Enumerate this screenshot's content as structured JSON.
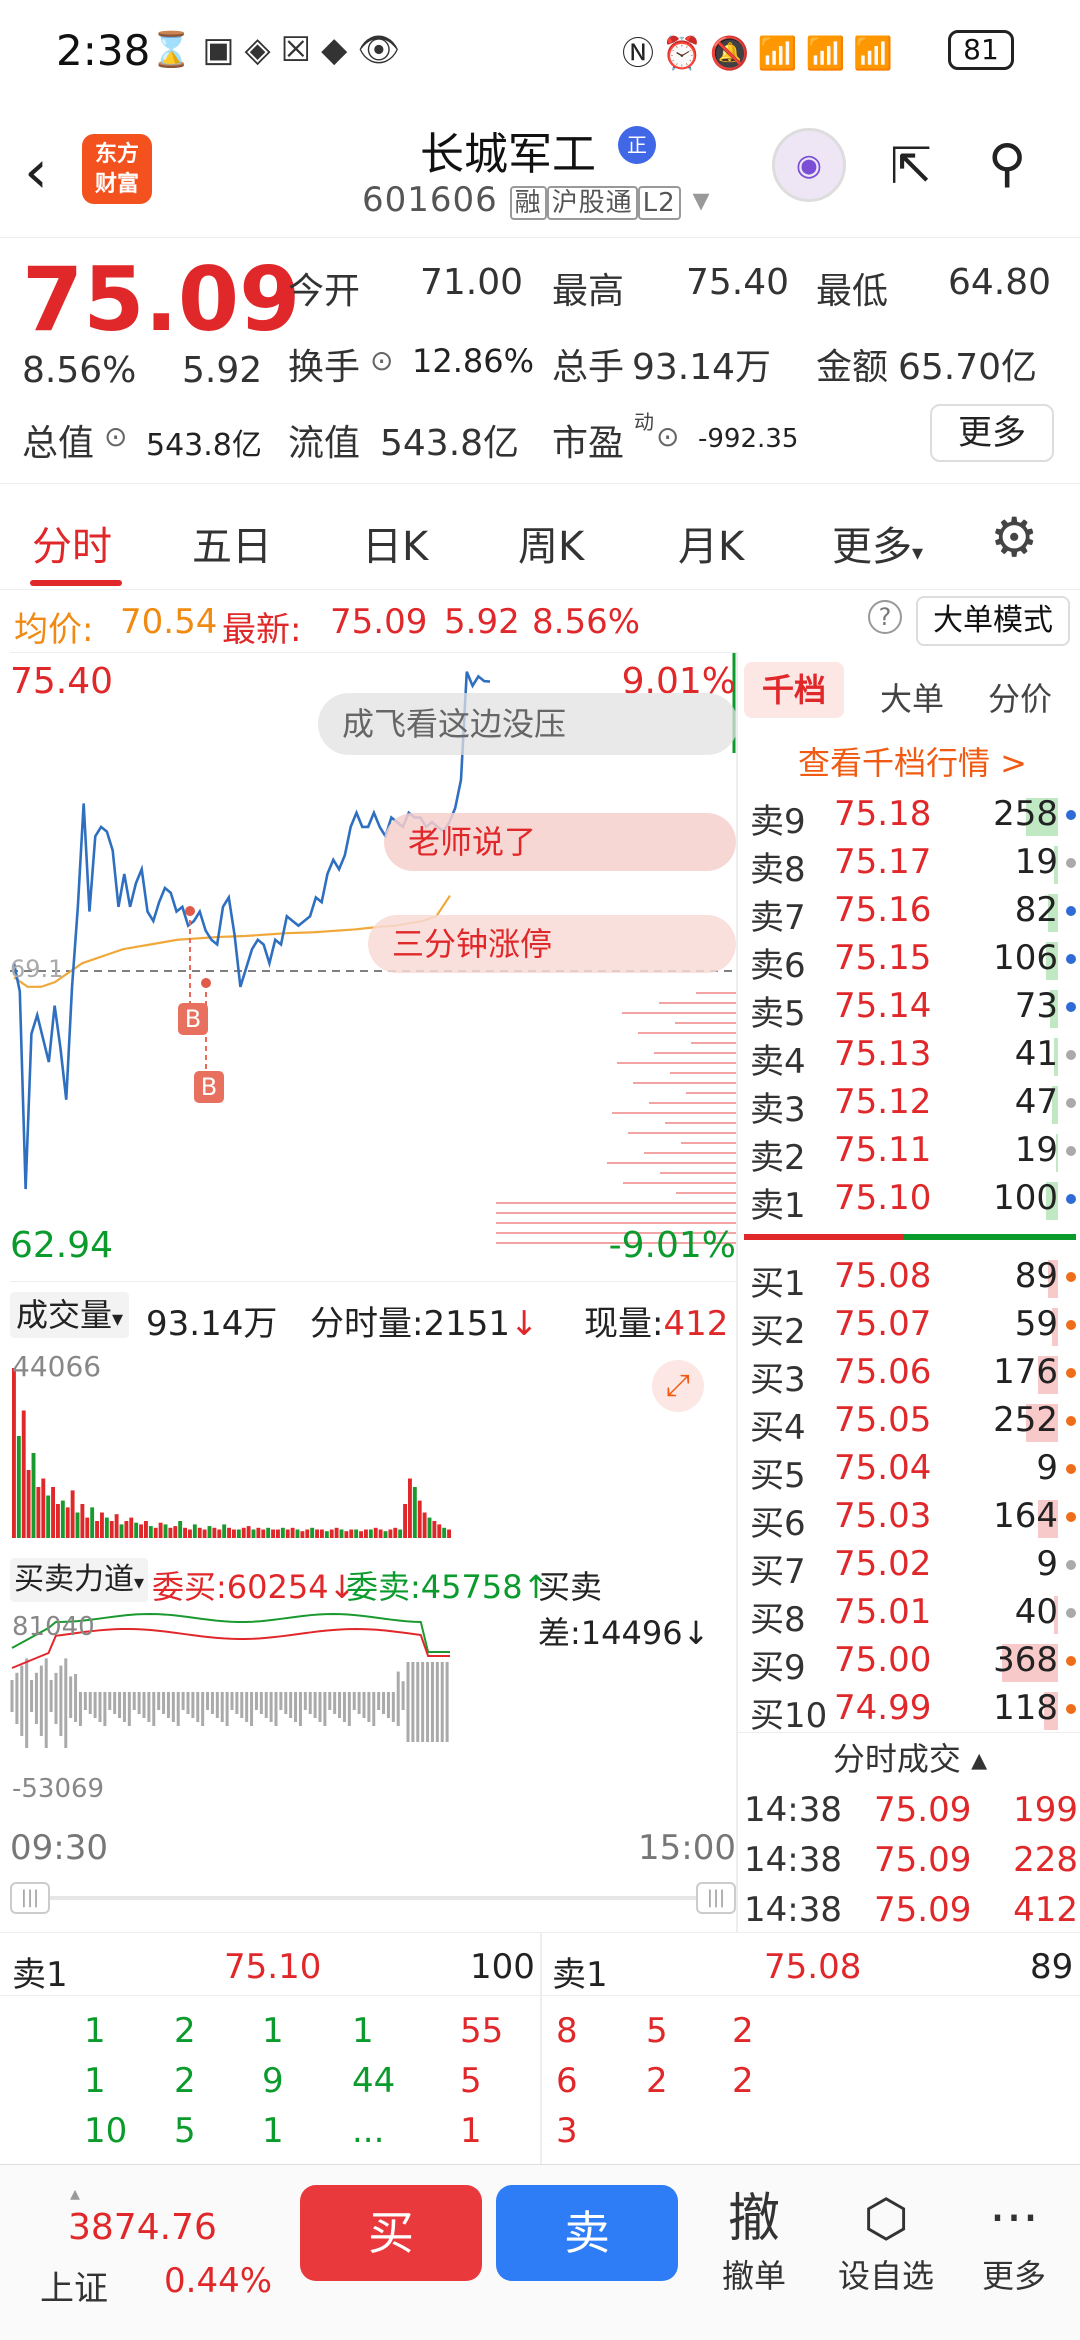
{
  "status_bar": {
    "time": "2:38",
    "battery": "81"
  },
  "header": {
    "title": "长城军工",
    "title_badge": "正",
    "code": "601606",
    "tags": [
      "融",
      "沪股通",
      "L2"
    ],
    "logo_line1": "东方",
    "logo_line2": "财富"
  },
  "quote": {
    "price": "75.09",
    "change_pct": "8.56%",
    "change": "5.92",
    "open_label": "今开",
    "open": "71.00",
    "high_label": "最高",
    "high": "75.40",
    "low_label": "最低",
    "low": "64.80",
    "turnover_label": "换手",
    "turnover": "12.86%",
    "volume_label": "总手",
    "volume": "93.14万",
    "amount_label": "金额",
    "amount": "65.70亿",
    "mktcap_label": "总值",
    "mktcap": "543.8亿",
    "float_label": "流值",
    "float": "543.8亿",
    "pe_label": "市盈",
    "pe_sup": "动",
    "pe": "-992.35",
    "more_label": "更多"
  },
  "tabs": [
    "分时",
    "五日",
    "日K",
    "周K",
    "月K",
    "更多"
  ],
  "avg_row": {
    "avg_label": "均价:",
    "avg": "70.54",
    "latest_label": "最新:",
    "latest": "75.09",
    "change": "5.92",
    "change_pct": "8.56%",
    "mode_label": "大单模式"
  },
  "chart": {
    "price_high": "75.40",
    "price_low": "62.94",
    "pct_high": "9.01%",
    "pct_low": "-9.01%",
    "mid_label": "69.1",
    "marker_label": "B",
    "overlays": [
      "成飞看这边没压",
      "老师说了",
      "三分钟涨停"
    ]
  },
  "chart_data": {
    "type": "line",
    "title": "",
    "ylim": [
      62.94,
      75.4
    ],
    "series": [
      {
        "values": [
          69.1,
          68.5,
          64.3,
          67.6,
          68.0,
          67.5,
          67.0,
          68.2,
          67.3,
          66.2,
          68.6,
          70.3,
          72.5,
          70.2,
          71.8,
          72.0,
          71.9,
          71.5,
          70.3,
          71.0,
          70.3,
          70.8,
          71.1,
          70.2,
          70.0,
          70.4,
          70.7,
          70.6,
          70.2,
          70.3,
          69.9,
          70.0,
          70.2,
          69.8,
          69.6,
          69.5,
          70.3,
          70.5,
          69.7,
          68.6,
          69.0,
          69.4,
          69.6,
          69.5,
          69.1,
          69.6,
          69.5,
          70.1,
          70.0,
          69.9,
          70.0,
          70.1,
          70.5,
          70.4,
          71.0,
          71.3,
          71.1,
          71.4,
          72.0,
          72.3,
          72.0,
          72.0,
          72.3,
          72.0,
          71.8,
          72.2,
          72.1,
          72.0,
          72.3,
          72.2,
          72.2,
          72.0,
          72.1,
          72.0,
          71.9,
          72.1,
          72.4,
          73.0,
          75.3,
          75.0,
          75.2,
          75.1,
          75.09
        ]
      },
      {
        "values": [
          68.8,
          68.6,
          68.6,
          68.7,
          68.9,
          69.1,
          69.2,
          69.3,
          69.4,
          69.45,
          69.5,
          69.55,
          69.6,
          69.62,
          69.64,
          69.66,
          69.67,
          69.68,
          69.7,
          69.72,
          69.74,
          69.75,
          69.76,
          69.78,
          69.8,
          69.82,
          69.85,
          69.88,
          69.9,
          69.95,
          70.0,
          70.1,
          70.54
        ]
      }
    ]
  },
  "book": {
    "tabs": [
      "千档",
      "大单",
      "分价"
    ],
    "link": "查看千档行情 >",
    "asks": [
      {
        "label": "卖9",
        "price": "75.18",
        "vol": "258",
        "bar": 0.16,
        "dot": "#2e6bd6"
      },
      {
        "label": "卖8",
        "price": "75.17",
        "vol": "19",
        "bar": 0.02,
        "dot": "#aaaaaa"
      },
      {
        "label": "卖7",
        "price": "75.16",
        "vol": "82",
        "bar": 0.05,
        "dot": "#2e6bd6"
      },
      {
        "label": "卖6",
        "price": "75.15",
        "vol": "106",
        "bar": 0.06,
        "dot": "#2e6bd6"
      },
      {
        "label": "卖5",
        "price": "75.14",
        "vol": "73",
        "bar": 0.04,
        "dot": "#2e6bd6"
      },
      {
        "label": "卖4",
        "price": "75.13",
        "vol": "41",
        "bar": 0.02,
        "dot": "#aaaaaa"
      },
      {
        "label": "卖3",
        "price": "75.12",
        "vol": "47",
        "bar": 0.03,
        "dot": "#aaaaaa"
      },
      {
        "label": "卖2",
        "price": "75.11",
        "vol": "19",
        "bar": 0.01,
        "dot": "#aaaaaa"
      },
      {
        "label": "卖1",
        "price": "75.10",
        "vol": "100",
        "bar": 0.06,
        "dot": "#2e6bd6"
      }
    ],
    "bids": [
      {
        "label": "买1",
        "price": "75.08",
        "vol": "89",
        "bar": 0.05,
        "dot": "#ef6c1a"
      },
      {
        "label": "买2",
        "price": "75.07",
        "vol": "59",
        "bar": 0.03,
        "dot": "#ef6c1a"
      },
      {
        "label": "买3",
        "price": "75.06",
        "vol": "176",
        "bar": 0.1,
        "dot": "#ef6c1a"
      },
      {
        "label": "买4",
        "price": "75.05",
        "vol": "252",
        "bar": 0.16,
        "dot": "#ef6c1a"
      },
      {
        "label": "买5",
        "price": "75.04",
        "vol": "9",
        "bar": 0.0,
        "dot": "#ef6c1a"
      },
      {
        "label": "买6",
        "price": "75.03",
        "vol": "164",
        "bar": 0.1,
        "dot": "#ef6c1a"
      },
      {
        "label": "买7",
        "price": "75.02",
        "vol": "9",
        "bar": 0.0,
        "dot": "#aaaaaa"
      },
      {
        "label": "买8",
        "price": "75.01",
        "vol": "40",
        "bar": 0.02,
        "dot": "#aaaaaa"
      },
      {
        "label": "买9",
        "price": "75.00",
        "vol": "368",
        "bar": 0.28,
        "dot": "#ef6c1a"
      },
      {
        "label": "买10",
        "price": "74.99",
        "vol": "118",
        "bar": 0.07,
        "dot": "#ef6c1a"
      }
    ],
    "trades_title": "分时成交",
    "trades": [
      {
        "time": "14:38",
        "price": "75.09",
        "vol": "199"
      },
      {
        "time": "14:38",
        "price": "75.09",
        "vol": "228"
      },
      {
        "time": "14:38",
        "price": "75.09",
        "vol": "412"
      }
    ]
  },
  "volume": {
    "label": "成交量",
    "total": "93.14万",
    "minute_label": "分时量:",
    "minute": "2151",
    "current_label": "现量:",
    "current": "412",
    "max": "44066"
  },
  "flow": {
    "label": "买卖力道",
    "buy_label": "委买:",
    "buy": "60254",
    "sell_label": "委卖:",
    "sell": "45758",
    "diff_label": "买卖差:",
    "diff": "14496",
    "top": "81040",
    "bottom": "-53069"
  },
  "time_axis": {
    "start": "09:30",
    "end": "15:00"
  },
  "levels": {
    "left_label": "卖1",
    "left_price": "75.10",
    "left_vol": "100",
    "right_label": "卖1",
    "right_price": "75.08",
    "right_vol": "89",
    "left_rows": [
      [
        "1",
        "2",
        "1",
        "1"
      ],
      [
        "1",
        "2",
        "9",
        "44"
      ],
      [
        "10",
        "5",
        "1",
        "..."
      ]
    ],
    "right_rows": [
      [
        "55",
        "8",
        "5",
        "2"
      ],
      [
        "5",
        "6",
        "2",
        "2"
      ],
      [
        "1",
        "3",
        "",
        ""
      ]
    ]
  },
  "bottom_nav": {
    "index_value": "3874.76",
    "index_name": "上证",
    "index_change": "0.44%",
    "buy": "买",
    "sell": "卖",
    "items": [
      "撤单",
      "设自选",
      "更多"
    ],
    "cancel_glyph": "撤"
  }
}
